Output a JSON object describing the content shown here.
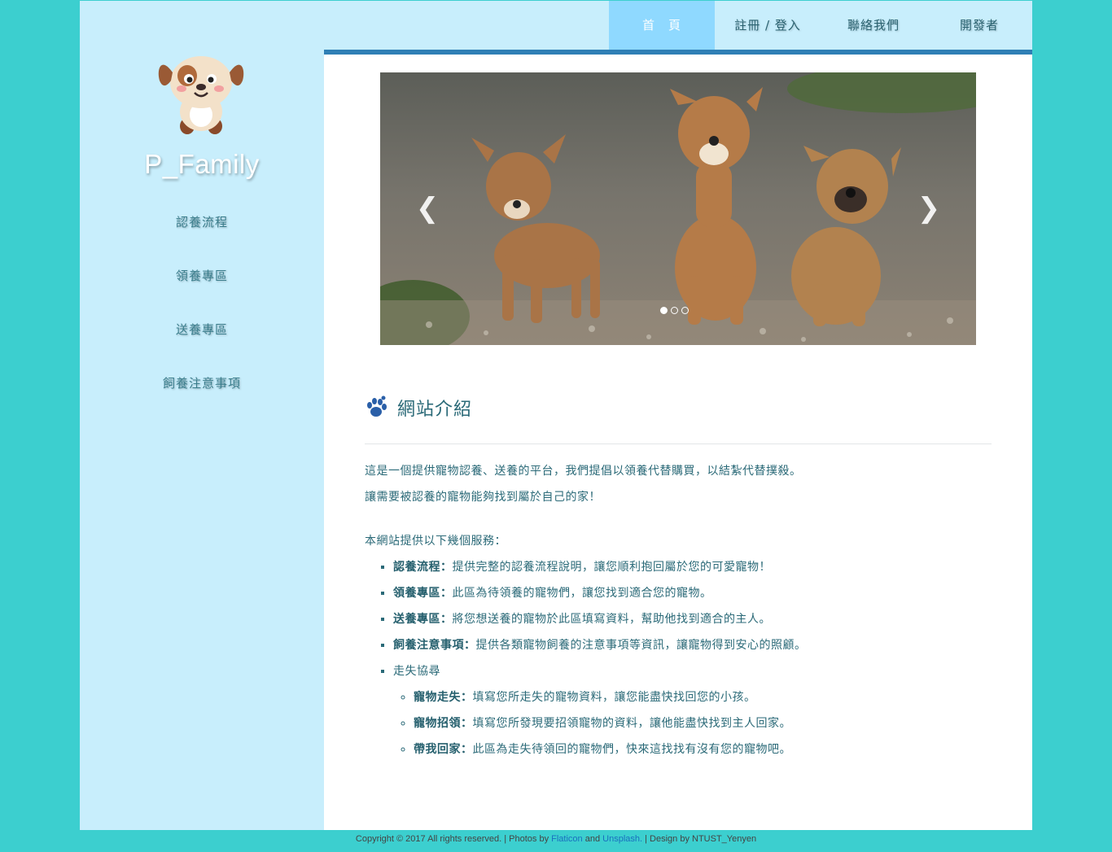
{
  "brand": {
    "name": "P_Family"
  },
  "sidebar": {
    "items": [
      {
        "label": "認養流程"
      },
      {
        "label": "領養專區"
      },
      {
        "label": "送養專區"
      },
      {
        "label": "飼養注意事項"
      }
    ]
  },
  "topnav": {
    "items": [
      {
        "label": "首　頁",
        "active": true
      },
      {
        "label": "註冊 / 登入"
      },
      {
        "label": "聯絡我們"
      },
      {
        "label": "開發者"
      }
    ]
  },
  "carousel": {
    "prev_icon": "chevron-left-icon",
    "next_icon": "chevron-right-icon",
    "prev_glyph": "❮",
    "next_glyph": "❯",
    "slide_count": 3,
    "active_slide": 1
  },
  "intro": {
    "title": "網站介紹",
    "icon": "paw-icon",
    "line1": "這是一個提供寵物認養、送養的平台，我們提倡以領養代替購買，以結紮代替撲殺。",
    "line2": "讓需要被認養的寵物能夠找到屬於自己的家！",
    "services_heading": "本網站提供以下幾個服務：",
    "services": [
      {
        "name": "認養流程：",
        "desc": "提供完整的認養流程說明，讓您順利抱回屬於您的可愛寵物！"
      },
      {
        "name": "領養專區：",
        "desc": "此區為待領養的寵物們，讓您找到適合您的寵物。"
      },
      {
        "name": "送養專區：",
        "desc": "將您想送養的寵物於此區填寫資料，幫助他找到適合的主人。"
      },
      {
        "name": "飼養注意事項：",
        "desc": "提供各類寵物飼養的注意事項等資訊，讓寵物得到安心的照顧。"
      },
      {
        "name": "走失協尋",
        "desc": ""
      }
    ],
    "lost_services": [
      {
        "name": "寵物走失：",
        "desc": "填寫您所走失的寵物資料，讓您能盡快找回您的小孩。"
      },
      {
        "name": "寵物招領：",
        "desc": "填寫您所發現要招領寵物的資料，讓他能盡快找到主人回家。"
      },
      {
        "name": "帶我回家：",
        "desc": "此區為走失待領回的寵物們，快來這找找有沒有您的寵物吧。"
      }
    ]
  },
  "footer": {
    "copyright": "Copyright © 2017 All rights reserved. | Photos by ",
    "flaticon": "Flaticon",
    "and": " and ",
    "unsplash": "Unsplash.",
    "design": " | Design by NTUST_Yenyen"
  },
  "colors": {
    "background": "#3ccfcf",
    "sidebar": "#c8eefc",
    "nav_active": "#8fd9ff",
    "nav_border": "#2f7fb5",
    "text": "#2b6a78",
    "paw": "#2a5fa8"
  }
}
